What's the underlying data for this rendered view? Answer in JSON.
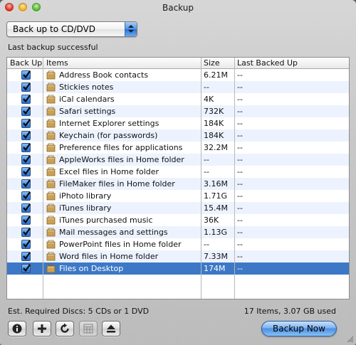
{
  "window": {
    "title": "Backup"
  },
  "destination": {
    "selected": "Back up to CD/DVD"
  },
  "status_message": "Last backup successful",
  "table": {
    "columns": {
      "backup": "Back Up",
      "items": "Items",
      "size": "Size",
      "last": "Last Backed Up"
    },
    "rows": [
      {
        "name": "Address Book contacts",
        "size": "6.21M",
        "last": "--",
        "checked": true
      },
      {
        "name": "Stickies notes",
        "size": "--",
        "last": "--",
        "checked": true
      },
      {
        "name": "iCal calendars",
        "size": "4K",
        "last": "--",
        "checked": true
      },
      {
        "name": "Safari settings",
        "size": "732K",
        "last": "--",
        "checked": true
      },
      {
        "name": "Internet Explorer settings",
        "size": "184K",
        "last": "--",
        "checked": true
      },
      {
        "name": "Keychain (for passwords)",
        "size": "184K",
        "last": "--",
        "checked": true
      },
      {
        "name": "Preference files for applications",
        "size": "32.2M",
        "last": "--",
        "checked": true
      },
      {
        "name": "AppleWorks files in Home folder",
        "size": "--",
        "last": "--",
        "checked": true
      },
      {
        "name": "Excel files in Home folder",
        "size": "--",
        "last": "--",
        "checked": true
      },
      {
        "name": "FileMaker files in Home folder",
        "size": "3.16M",
        "last": "--",
        "checked": true
      },
      {
        "name": "iPhoto library",
        "size": "1.71G",
        "last": "--",
        "checked": true
      },
      {
        "name": "iTunes library",
        "size": "15.4M",
        "last": "--",
        "checked": true
      },
      {
        "name": "iTunes purchased music",
        "size": "36K",
        "last": "--",
        "checked": true
      },
      {
        "name": "Mail messages and settings",
        "size": "1.13G",
        "last": "--",
        "checked": true
      },
      {
        "name": "PowerPoint files in Home folder",
        "size": "--",
        "last": "--",
        "checked": true
      },
      {
        "name": "Word files in Home folder",
        "size": "7.33M",
        "last": "--",
        "checked": true
      },
      {
        "name": "Files on Desktop",
        "size": "174M",
        "last": "--",
        "checked": true,
        "selected": true
      }
    ]
  },
  "footer": {
    "required_discs": "Est. Required Discs: 5 CDs or 1 DVD",
    "summary": "17 Items, 3.07 GB used"
  },
  "toolbar": {
    "icons": [
      "info-icon",
      "add-icon",
      "refresh-icon",
      "calendar-icon",
      "eject-icon"
    ],
    "backup_now": "Backup Now"
  },
  "colors": {
    "selection": "#3d78c6",
    "alt_row": "#edf3fe",
    "accent": "#4d8fe2"
  }
}
